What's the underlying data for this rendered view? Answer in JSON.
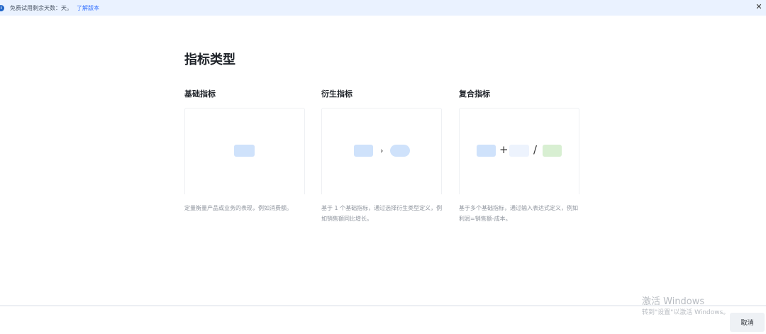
{
  "banner": {
    "message": "免费试用剩余天数：天。",
    "link": "了解版本",
    "info_icon": "info-icon",
    "close_icon": "close-icon"
  },
  "page_title": "指标类型",
  "cards": [
    {
      "label": "基础指标",
      "description": "定量衡量产品或业务的表现，例如消费额。"
    },
    {
      "label": "衍生指标",
      "description": "基于 1 个基础指标，通过选择衍生类型定义，例如销售额同比增长。"
    },
    {
      "label": "复合指标",
      "description": "基于多个基础指标，通过输入表达式定义，例如利润=销售额-成本。"
    }
  ],
  "operators": {
    "derived_arrow": "›",
    "plus": "+",
    "divide": "/"
  },
  "footer": {
    "cancel_label": "取消"
  },
  "watermark": {
    "line1": "激活 Windows",
    "line2": "转到\"设置\"以激活 Windows。"
  },
  "colors": {
    "accent": "#3370ff",
    "banner_bg": "#eaf2ff",
    "shape_blue": "#cfe2fb",
    "shape_light": "#edf3fd",
    "shape_green": "#d8efd2"
  }
}
